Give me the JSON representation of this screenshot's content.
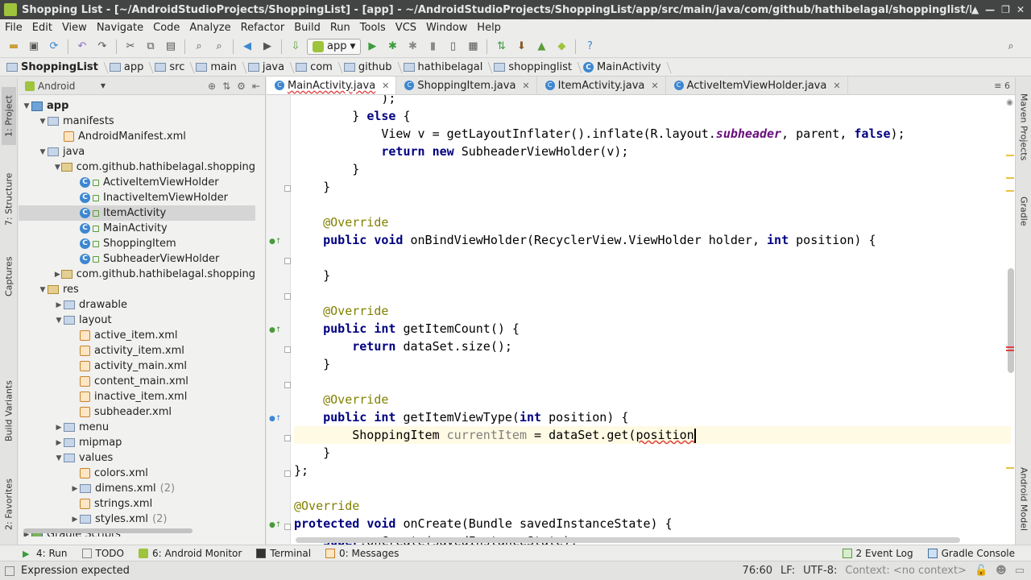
{
  "window": {
    "title": "Shopping List - [~/AndroidStudioProjects/ShoppingList] - [app] - ~/AndroidStudioProjects/ShoppingList/app/src/main/java/com/github/hathibelagal/shoppinglist/MainActivit"
  },
  "menu": [
    "File",
    "Edit",
    "View",
    "Navigate",
    "Code",
    "Analyze",
    "Refactor",
    "Build",
    "Run",
    "Tools",
    "VCS",
    "Window",
    "Help"
  ],
  "toolbar": {
    "run_config": "app"
  },
  "breadcrumb": [
    "ShoppingList",
    "app",
    "src",
    "main",
    "java",
    "com",
    "github",
    "hathibelagal",
    "shoppinglist",
    "MainActivity"
  ],
  "left_stripe": {
    "project": "1: Project",
    "structure": "7: Structure",
    "captures": "Captures",
    "build_variants": "Build Variants",
    "favorites": "2: Favorites"
  },
  "right_stripe": {
    "maven": "Maven Projects",
    "gradle": "Gradle",
    "android_model": "Android Model"
  },
  "project_panel": {
    "view_selector": "Android",
    "tree": [
      {
        "label": "app",
        "depth": 0,
        "arrow": "down",
        "icon": "module",
        "bold": true
      },
      {
        "label": "manifests",
        "depth": 1,
        "arrow": "down",
        "icon": "folder"
      },
      {
        "label": "AndroidManifest.xml",
        "depth": 2,
        "arrow": "",
        "icon": "xml"
      },
      {
        "label": "java",
        "depth": 1,
        "arrow": "down",
        "icon": "folder"
      },
      {
        "label": "com.github.hathibelagal.shopping",
        "depth": 2,
        "arrow": "down",
        "icon": "package"
      },
      {
        "label": "ActiveItemViewHolder",
        "depth": 3,
        "arrow": "",
        "icon": "class"
      },
      {
        "label": "InactiveItemViewHolder",
        "depth": 3,
        "arrow": "",
        "icon": "class"
      },
      {
        "label": "ItemActivity",
        "depth": 3,
        "arrow": "",
        "icon": "class",
        "selected": true
      },
      {
        "label": "MainActivity",
        "depth": 3,
        "arrow": "",
        "icon": "class"
      },
      {
        "label": "ShoppingItem",
        "depth": 3,
        "arrow": "",
        "icon": "class"
      },
      {
        "label": "SubheaderViewHolder",
        "depth": 3,
        "arrow": "",
        "icon": "class"
      },
      {
        "label": "com.github.hathibelagal.shopping",
        "depth": 2,
        "arrow": "right",
        "icon": "package"
      },
      {
        "label": "res",
        "depth": 1,
        "arrow": "down",
        "icon": "resfolder"
      },
      {
        "label": "drawable",
        "depth": 2,
        "arrow": "right",
        "icon": "folder"
      },
      {
        "label": "layout",
        "depth": 2,
        "arrow": "down",
        "icon": "folder"
      },
      {
        "label": "active_item.xml",
        "depth": 3,
        "arrow": "",
        "icon": "xml"
      },
      {
        "label": "activity_item.xml",
        "depth": 3,
        "arrow": "",
        "icon": "xml"
      },
      {
        "label": "activity_main.xml",
        "depth": 3,
        "arrow": "",
        "icon": "xml"
      },
      {
        "label": "content_main.xml",
        "depth": 3,
        "arrow": "",
        "icon": "xml"
      },
      {
        "label": "inactive_item.xml",
        "depth": 3,
        "arrow": "",
        "icon": "xml"
      },
      {
        "label": "subheader.xml",
        "depth": 3,
        "arrow": "",
        "icon": "xml"
      },
      {
        "label": "menu",
        "depth": 2,
        "arrow": "right",
        "icon": "folder"
      },
      {
        "label": "mipmap",
        "depth": 2,
        "arrow": "right",
        "icon": "folder"
      },
      {
        "label": "values",
        "depth": 2,
        "arrow": "down",
        "icon": "folder"
      },
      {
        "label": "colors.xml",
        "depth": 3,
        "arrow": "",
        "icon": "xml"
      },
      {
        "label": "dimens.xml",
        "depth": 3,
        "arrow": "right",
        "icon": "folder",
        "count": "(2)"
      },
      {
        "label": "strings.xml",
        "depth": 3,
        "arrow": "",
        "icon": "xml"
      },
      {
        "label": "styles.xml",
        "depth": 3,
        "arrow": "right",
        "icon": "folder",
        "count": "(2)"
      },
      {
        "label": "Gradle Scripts",
        "depth": 0,
        "arrow": "right",
        "icon": "gradle"
      }
    ]
  },
  "editor": {
    "tabs": [
      {
        "label": "MainActivity.java",
        "active": true,
        "error": true
      },
      {
        "label": "ShoppingItem.java",
        "active": false
      },
      {
        "label": "ItemActivity.java",
        "active": false
      },
      {
        "label": "ActiveItemViewHolder.java",
        "active": false
      }
    ],
    "tab_count": "6",
    "code_lines": [
      "            );",
      "        } else {",
      "            View v = getLayoutInflater().inflate(R.layout.subheader, parent, false);",
      "            return new SubheaderViewHolder(v);",
      "        }",
      "    }",
      "",
      "    @Override",
      "    public void onBindViewHolder(RecyclerView.ViewHolder holder, int position) {",
      "",
      "    }",
      "",
      "    @Override",
      "    public int getItemCount() {",
      "        return dataSet.size();",
      "    }",
      "",
      "    @Override",
      "    public int getItemViewType(int position) {",
      "        ShoppingItem currentItem = dataSet.get(position",
      "    }",
      "};",
      "",
      "@Override",
      "protected void onCreate(Bundle savedInstanceState) {",
      "    super.onCreate(savedInstanceState);"
    ]
  },
  "bottom_tabs": [
    {
      "label": "4: Run"
    },
    {
      "label": "TODO"
    },
    {
      "label": "6: Android Monitor"
    },
    {
      "label": "Terminal"
    },
    {
      "label": "0: Messages"
    }
  ],
  "bottom_tabs_right": [
    {
      "label": "2 Event Log"
    },
    {
      "label": "Gradle Console"
    }
  ],
  "status": {
    "message": "Expression expected",
    "position": "76:60",
    "line_sep": "LF:",
    "encoding": "UTF-8:",
    "context": "Context: <no context>"
  },
  "colors": {
    "keyword": "#000080",
    "annotation": "#808000",
    "field": "#660e7a",
    "unused": "#808080",
    "current_line": "#fffae3"
  }
}
